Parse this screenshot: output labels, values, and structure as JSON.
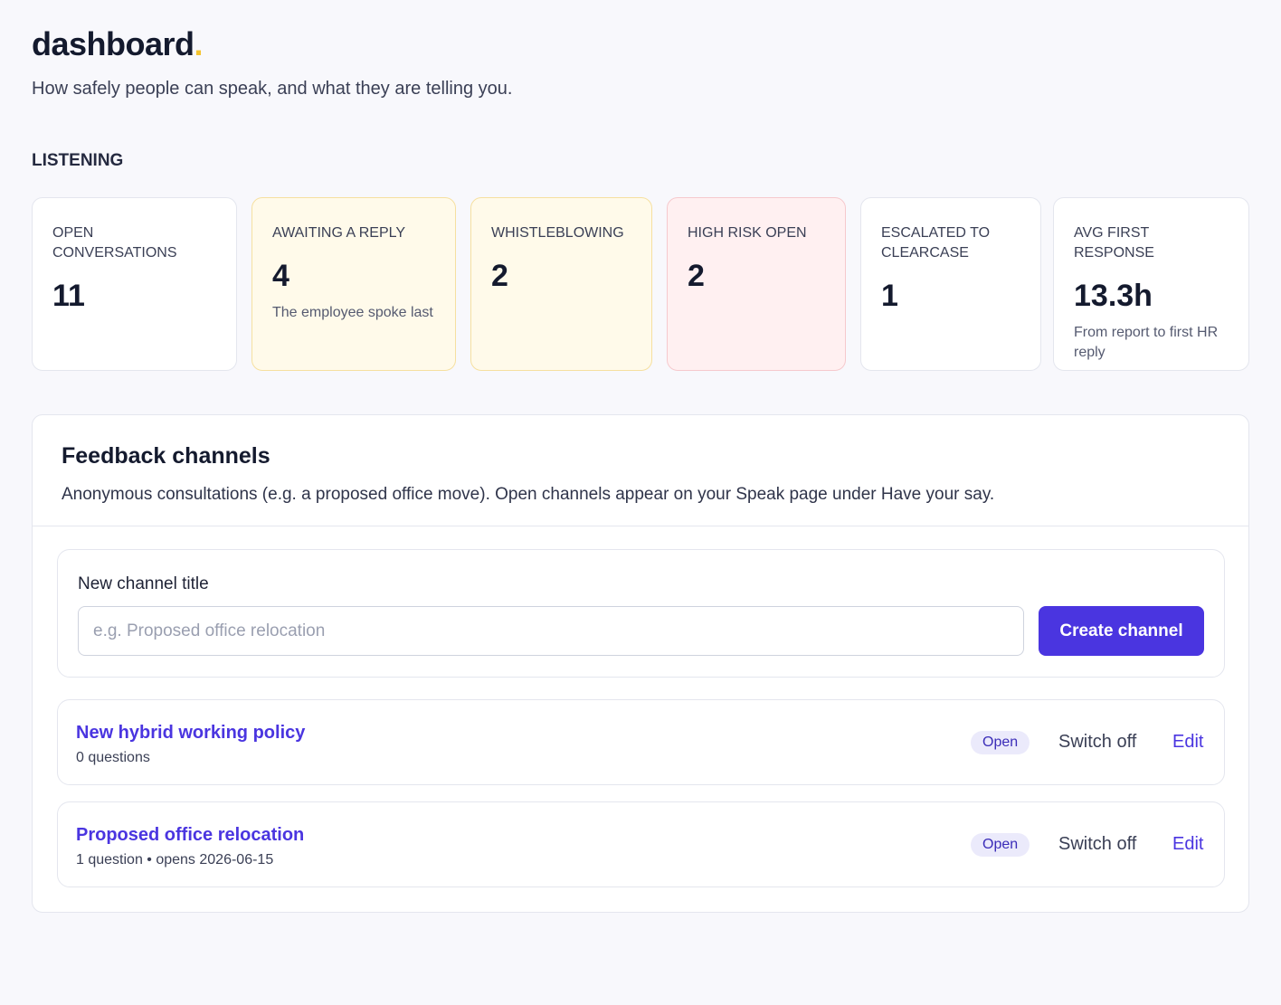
{
  "header": {
    "title": "dashboard",
    "title_dot": ".",
    "subtitle": "How safely people can speak, and what they are telling you."
  },
  "listening": {
    "label": "LISTENING",
    "stats": [
      {
        "label": "OPEN CONVERSATIONS",
        "value": "11",
        "note": ""
      },
      {
        "label": "AWAITING A REPLY",
        "value": "4",
        "note": "The employee spoke last"
      },
      {
        "label": "WHISTLEBLOWING",
        "value": "2",
        "note": ""
      },
      {
        "label": "HIGH RISK OPEN",
        "value": "2",
        "note": ""
      },
      {
        "label": "ESCALATED TO CLEARCASE",
        "value": "1",
        "note": ""
      },
      {
        "label": "AVG FIRST RESPONSE",
        "value": "13.3h",
        "note": "From report to first HR reply"
      }
    ]
  },
  "feedback": {
    "title": "Feedback channels",
    "description": "Anonymous consultations (e.g. a proposed office move). Open channels appear on your Speak page under Have your say.",
    "new_channel": {
      "label": "New channel title",
      "placeholder": "e.g. Proposed office relocation",
      "value": "",
      "button_label": "Create channel"
    },
    "channels": [
      {
        "title": "New hybrid working policy",
        "meta": "0 questions",
        "status": "Open",
        "switch_label": "Switch off",
        "edit_label": "Edit"
      },
      {
        "title": "Proposed office relocation",
        "meta": "1 question • opens 2026-06-15",
        "status": "Open",
        "switch_label": "Switch off",
        "edit_label": "Edit"
      }
    ]
  },
  "colors": {
    "accent": "#4a35e0",
    "title_dot": "#f4c430",
    "amber_card": "#fffaea",
    "red_card": "#fff0f1"
  }
}
